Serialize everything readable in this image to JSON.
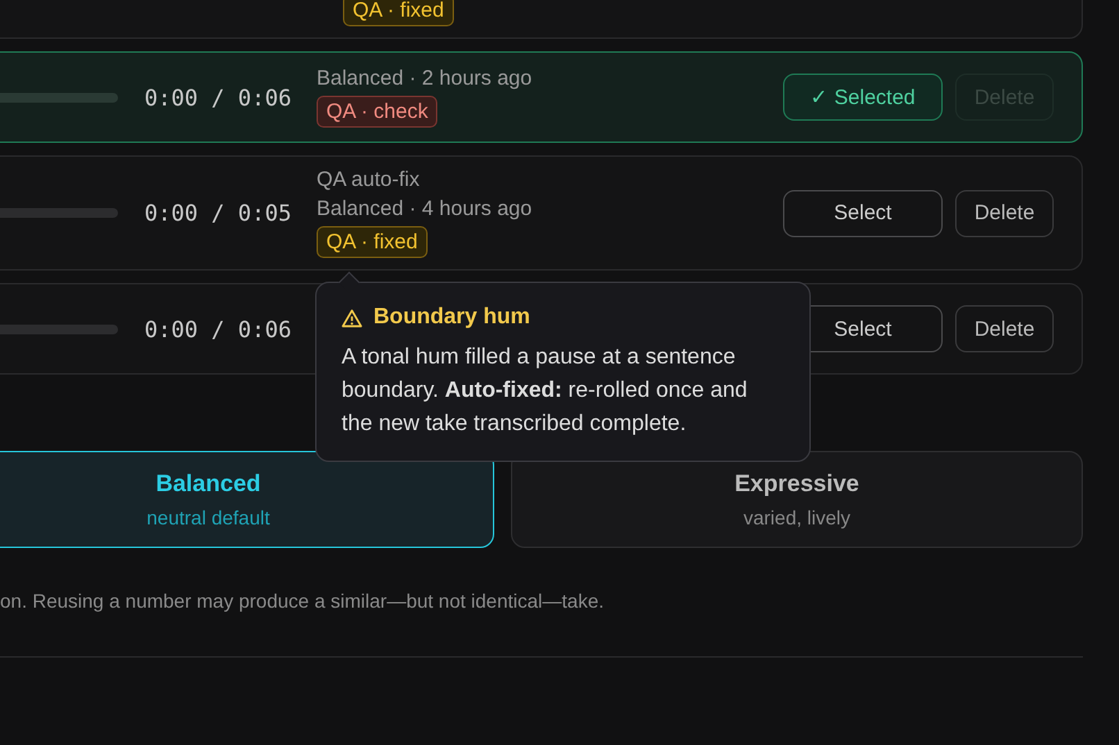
{
  "takes": [
    {
      "selected": false,
      "tag": {
        "kind": "fixed",
        "label": "QA · fixed"
      }
    },
    {
      "selected": true,
      "time": "0:00 / 0:06",
      "meta": "Balanced · 2 hours ago",
      "tag": {
        "kind": "check",
        "label": "QA · check"
      },
      "select_label": "✓ Selected",
      "delete": {
        "label": "Delete",
        "disabled": true
      }
    },
    {
      "selected": false,
      "time": "0:00 / 0:05",
      "note": "QA auto-fix",
      "meta": "Balanced · 4 hours ago",
      "tag": {
        "kind": "fixed",
        "label": "QA · fixed"
      },
      "select_label": "Select",
      "delete": {
        "label": "Delete",
        "disabled": false
      }
    },
    {
      "selected": false,
      "time": "0:00 / 0:06",
      "select_label": "Select",
      "delete": {
        "label": "Delete",
        "disabled": false
      }
    }
  ],
  "tooltip": {
    "title": "Boundary hum",
    "body": "A tonal hum filled a pause at a sentence boundary. **Auto-fixed:** re-rolled once and the new take transcribed complete."
  },
  "styles": [
    {
      "name": "Balanced",
      "hint": "neutral default",
      "selected": true
    },
    {
      "name": "Expressive",
      "hint": "varied, lively",
      "selected": false
    }
  ],
  "note": "on. Reusing a number may produce a similar—but not identical—take."
}
